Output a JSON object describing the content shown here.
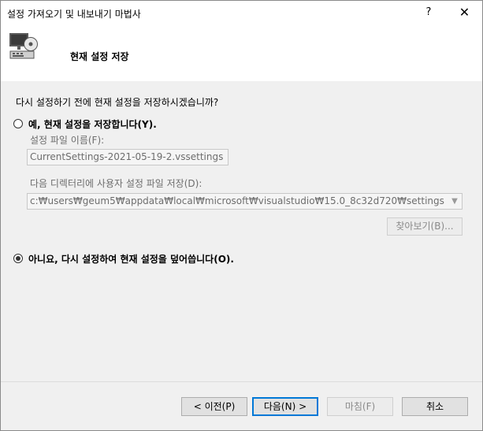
{
  "window": {
    "title": "설정 가져오기 및 내보내기 마법사",
    "help_label": "?",
    "close_label": "✕"
  },
  "header": {
    "title": "현재 설정 저장",
    "icon": "computer-settings-icon"
  },
  "main": {
    "prompt": "다시 설정하기 전에 현재 설정을 저장하시겠습니까?",
    "option_yes": {
      "label": "예, 현재 설정을 저장합니다(Y).",
      "selected": false
    },
    "filename": {
      "label": "설정 파일 이름(F):",
      "value": "CurrentSettings-2021-05-19-2.vssettings"
    },
    "directory": {
      "label": "다음 디렉터리에 사용자 설정 파일 저장(D):",
      "value": "c:₩users₩geum5₩appdata₩local₩microsoft₩visualstudio₩15.0_8c32d720₩settings"
    },
    "browse_label": "찾아보기(B)...",
    "option_no": {
      "label": "아니요, 다시 설정하여 현재 설정을 덮어씁니다(O).",
      "selected": true
    }
  },
  "footer": {
    "back_label": "< 이전(P)",
    "next_label": "다음(N) >",
    "finish_label": "마침(F)",
    "cancel_label": "취소"
  }
}
